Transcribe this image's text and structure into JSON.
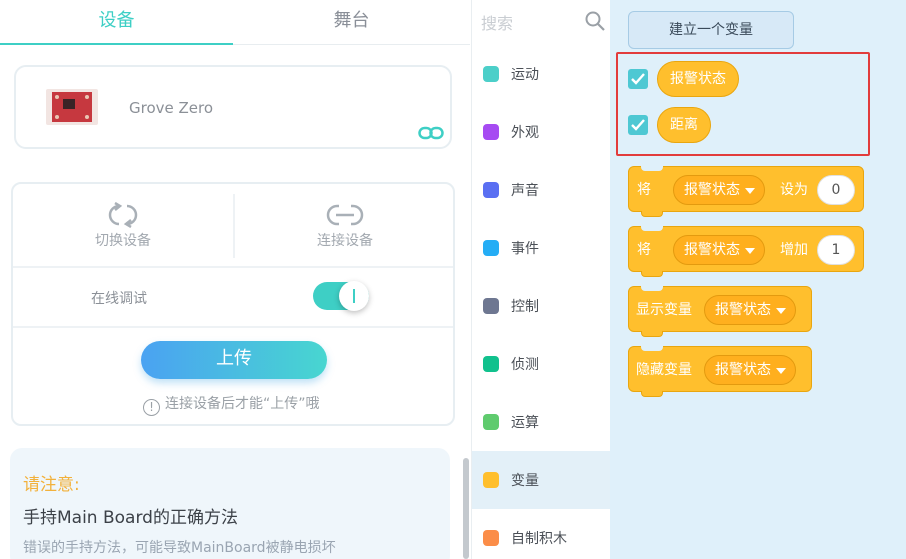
{
  "tabs": [
    {
      "label": "设备"
    },
    {
      "label": "舞台"
    }
  ],
  "device": {
    "name": "Grove Zero"
  },
  "controls": {
    "switch_label": "切换设备",
    "connect_label": "连接设备",
    "online_debug_label": "在线调试",
    "online_debug_on": true,
    "upload_label": "上传",
    "hint": "连接设备后才能“上传”哦"
  },
  "notice": {
    "title": "请注意:",
    "main": "手持Main Board的正确方法",
    "sub": "错误的手持方法，可能导致MainBoard被静电损坏"
  },
  "search": {
    "placeholder": "搜索"
  },
  "categories": [
    {
      "label": "运动",
      "color": "#4ccfc9"
    },
    {
      "label": "外观",
      "color": "#a64bf2"
    },
    {
      "label": "声音",
      "color": "#5a6ff2"
    },
    {
      "label": "事件",
      "color": "#25adf5"
    },
    {
      "label": "控制",
      "color": "#6e7791"
    },
    {
      "label": "侦测",
      "color": "#11c18d"
    },
    {
      "label": "运算",
      "color": "#5fcb6e"
    },
    {
      "label": "变量",
      "color": "#ffbf2d"
    },
    {
      "label": "自制积木",
      "color": "#fb8d48"
    }
  ],
  "active_category": "变量",
  "blocks": {
    "make_variable": "建立一个变量",
    "variables": [
      {
        "name": "报警状态",
        "checked": true
      },
      {
        "name": "距离",
        "checked": true
      }
    ],
    "set_block": {
      "prefix": "将",
      "var": "报警状态",
      "op": "设为",
      "value": "0"
    },
    "change_block": {
      "prefix": "将",
      "var": "报警状态",
      "op": "增加",
      "value": "1"
    },
    "show_block": {
      "label": "显示变量",
      "var": "报警状态"
    },
    "hide_block": {
      "label": "隐藏变量",
      "var": "报警状态"
    }
  }
}
